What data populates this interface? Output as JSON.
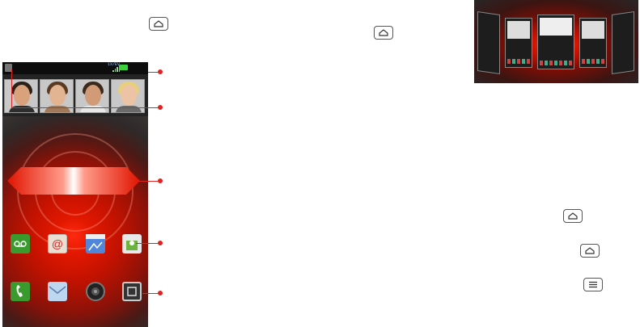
{
  "figure": {
    "status_bar": {
      "network_label": "1X/EV",
      "battery_color": "#3cd13c"
    },
    "callout_color": "#e02222",
    "icons": {
      "home_key_1": "home-key-icon",
      "home_key_2": "home-key-icon",
      "home_key_3": "home-key-icon",
      "home_key_4": "home-key-icon",
      "menu_key": "menu-key-icon"
    },
    "apps_row1": [
      "voicemail-icon",
      "email-icon",
      "maps-icon",
      "market-icon"
    ],
    "apps_row2": [
      "phone-icon",
      "messaging-icon",
      "camera-icon",
      "launcher-icon"
    ]
  }
}
